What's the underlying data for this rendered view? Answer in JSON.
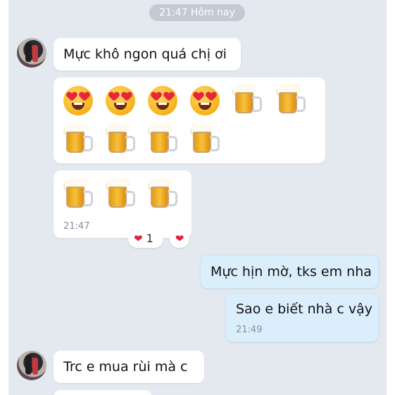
{
  "header": {
    "timestamp": "21:47 Hôm nay"
  },
  "messages": {
    "m1": {
      "text": "Mực khô ngon quá chị ơi"
    },
    "m2": {
      "emojis": [
        "heart-eyes",
        "heart-eyes",
        "heart-eyes",
        "heart-eyes",
        "beer-mug",
        "beer-mug",
        "beer-mug",
        "beer-mug",
        "beer-mug",
        "beer-mug"
      ]
    },
    "m3": {
      "emojis": [
        "beer-mug",
        "beer-mug",
        "beer-mug"
      ],
      "time": "21:47",
      "reaction_count": "1"
    },
    "m4": {
      "text": "Mực hịn mờ, tks em nha"
    },
    "m5": {
      "text": "Sao e biết nhà c vậy",
      "time": "21:49"
    },
    "m6": {
      "text": "Trc e mua rùi mà c"
    }
  },
  "icons": {
    "reaction": "heart-icon",
    "quick_react": "heart-icon"
  },
  "colors": {
    "chat_bg": "#e4e9f0",
    "incoming_bubble": "#ffffff",
    "outgoing_bubble": "#dbeefc",
    "reaction_heart": "#e3213b"
  }
}
